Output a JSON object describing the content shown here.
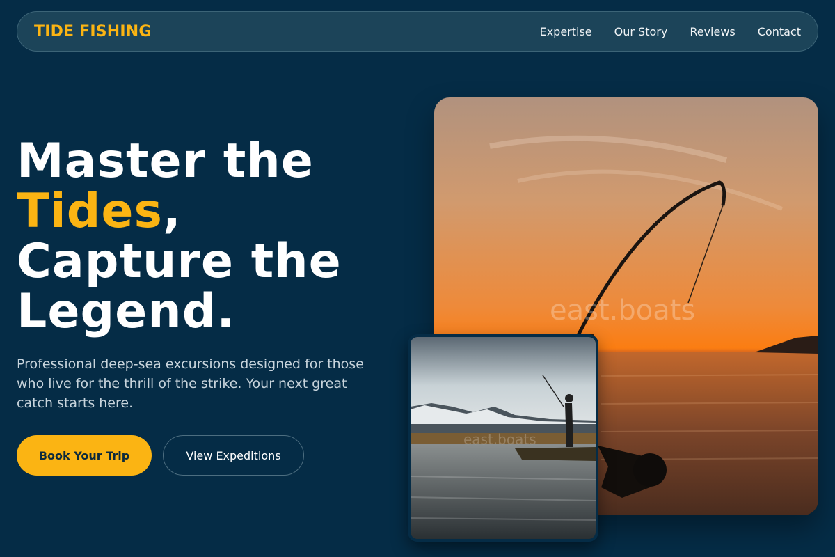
{
  "brand": {
    "name": "TIDE FISHING"
  },
  "nav": {
    "links": [
      "Expertise",
      "Our Story",
      "Reviews",
      "Contact"
    ]
  },
  "hero": {
    "title_line1": "Master the",
    "title_accent": "Tides",
    "title_comma": ",",
    "title_line3": "Capture the",
    "title_line4": "Legend.",
    "subtitle": "Professional deep-sea excursions designed for those who live for the thrill of the strike. Your next great catch starts here.",
    "primary_cta": "Book Your Trip",
    "secondary_cta": "View Expeditions"
  },
  "images": {
    "main_watermark": "east.boats",
    "inset_watermark": "east.boats"
  },
  "colors": {
    "background": "#052c46",
    "accent": "#fbb413",
    "navbar": "#1c4459"
  }
}
